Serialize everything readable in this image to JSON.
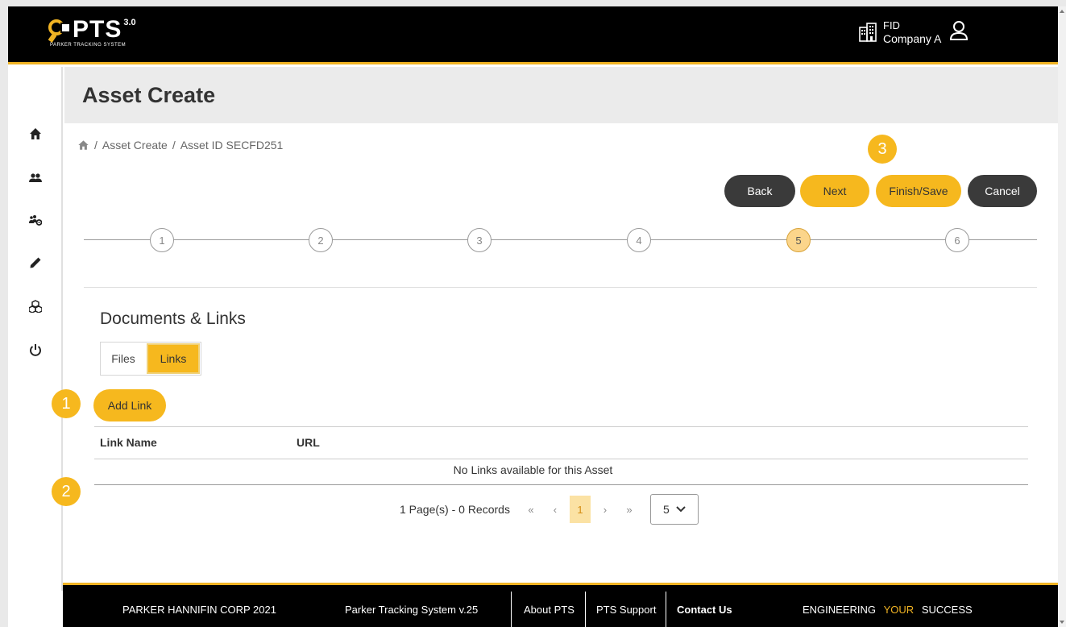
{
  "header": {
    "logo_text": "PTS",
    "logo_version": "3.0",
    "logo_subtitle": "PARKER TRACKING SYSTEM",
    "company_code": "FID",
    "company_name": "Company A"
  },
  "sidebar": {
    "items": [
      {
        "name": "home-icon"
      },
      {
        "name": "users-icon"
      },
      {
        "name": "user-settings-icon"
      },
      {
        "name": "pencil-icon"
      },
      {
        "name": "cubes-icon"
      },
      {
        "name": "power-icon"
      }
    ]
  },
  "page": {
    "title": "Asset Create",
    "breadcrumb": [
      "Asset Create",
      "Asset ID SECFD251"
    ]
  },
  "actions": {
    "back": "Back",
    "next": "Next",
    "finish": "Finish/Save",
    "cancel": "Cancel"
  },
  "stepper": {
    "steps": [
      "1",
      "2",
      "3",
      "4",
      "5",
      "6"
    ],
    "active": "5"
  },
  "callouts": [
    "1",
    "2",
    "3"
  ],
  "section": {
    "title": "Documents & Links",
    "tabs": {
      "files": "Files",
      "links": "Links"
    },
    "active_tab": "Links",
    "add_link": "Add Link",
    "columns": [
      "Link Name",
      "URL"
    ],
    "empty_message": "No Links available for this Asset"
  },
  "pagination": {
    "summary": "1 Page(s) - 0 Records",
    "first": "«",
    "prev": "‹",
    "current": "1",
    "next": "›",
    "last": "»",
    "page_size": "5"
  },
  "footer": {
    "copyright": "PARKER HANNIFIN CORP 2021",
    "version": "Parker Tracking System v.25",
    "about": "About PTS",
    "support": "PTS Support",
    "contact": "Contact Us",
    "slogan_1": "ENGINEERING",
    "slogan_2": "YOUR",
    "slogan_3": "SUCCESS"
  },
  "colors": {
    "accent": "#f6b81e",
    "dark_button": "#3a3a3a",
    "header_bg": "#000000"
  }
}
